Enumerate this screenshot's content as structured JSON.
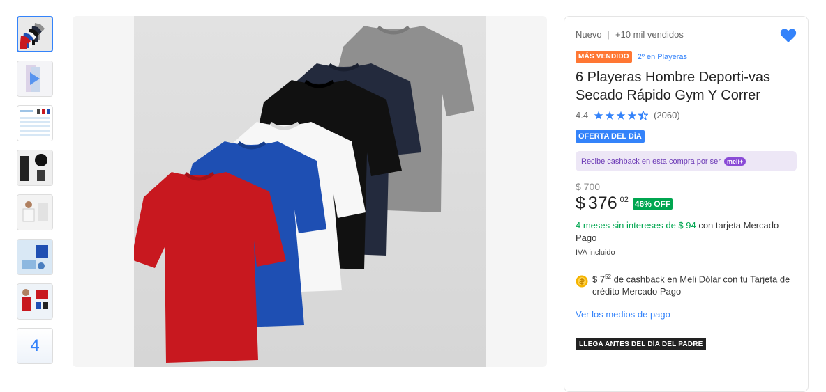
{
  "gallery": {
    "thumbnail_count_label": "4",
    "thumbnails": [
      "thumb-1",
      "thumb-2",
      "thumb-3",
      "thumb-4",
      "thumb-5",
      "thumb-6",
      "thumb-7"
    ],
    "shirt_colors": [
      "#8f8f8f",
      "#232a3d",
      "#111111",
      "#f7f7f7",
      "#1e4fb3",
      "#c8181f"
    ]
  },
  "product": {
    "condition": "Nuevo",
    "sold": "+10 mil vendidos",
    "badge_top": "MÁS VENDIDO",
    "rank_label": "2º en Playeras",
    "title": "6 Playeras Hombre Deporti-vas Secado Rápido Gym Y Correr",
    "rating_value": "4.4",
    "rating_count": "(2060)",
    "rating_stars": 4.4,
    "deal_badge": "OFERTA DEL DÍA",
    "cashback_text": "Recibe cashback en esta compra por ser",
    "cashback_tag": "meli+",
    "old_price": "$ 700",
    "price_currency": "$",
    "price_int": "376",
    "price_cents": "02",
    "discount": "46% OFF",
    "installments_green": "4 meses sin intereses de $ 94",
    "installments_rest": " con tarjeta Mercado Pago",
    "tax_note": "IVA incluido",
    "meli_dolar_prefix": "$ 7",
    "meli_dolar_cents": "52",
    "meli_dolar_text": " de cashback en Meli Dólar con tu Tarjeta de crédito Mercado Pago",
    "payment_link": "Ver los medios de pago",
    "arrival_badge": "LLEGA ANTES DEL DÍA DEL PADRE"
  },
  "colors": {
    "accent": "#3483fa",
    "success": "#00a650",
    "top_badge": "#ff7733"
  }
}
